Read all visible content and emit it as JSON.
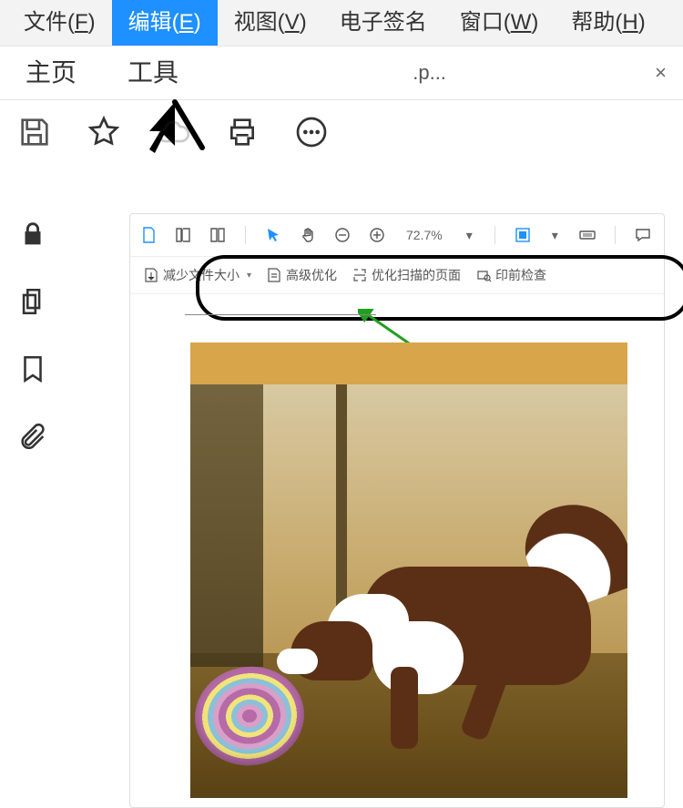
{
  "menu": {
    "file": "文件(F)",
    "edit": "编辑(E)",
    "view": "视图(V)",
    "esign": "电子签名",
    "window": "窗口(W)",
    "help": "帮助(H)"
  },
  "tabs": {
    "home": "主页",
    "tools": "工具",
    "docname": ".p...",
    "close": "×"
  },
  "panel": {
    "zoom": "72.7%",
    "opt_reduce": "减少文件大小",
    "opt_advanced": "高级优化",
    "opt_scanned": "优化扫描的页面",
    "opt_preflight": "印前检查"
  }
}
